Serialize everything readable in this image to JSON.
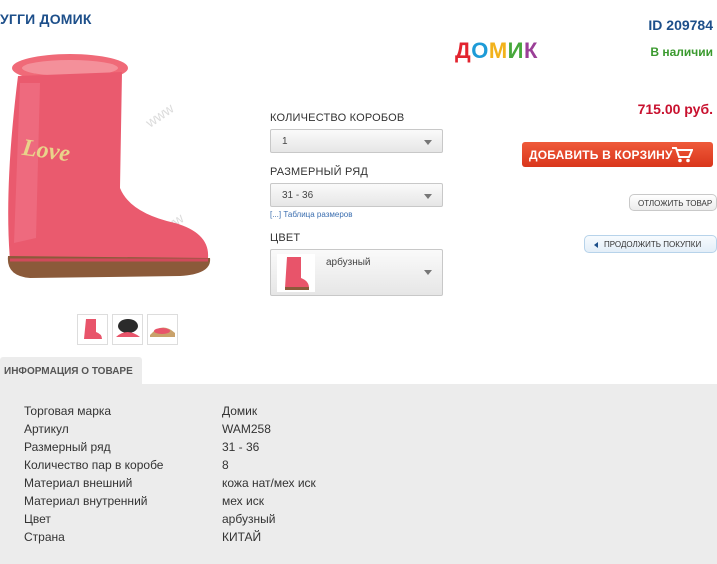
{
  "product": {
    "title": "УГГИ ДОМИК",
    "id_label": "ID 209784",
    "brand_logo": "ДОМИК",
    "stock": "В наличии",
    "price": "715.00 руб.",
    "main_color": "#e8546a"
  },
  "options": {
    "boxes_label": "КОЛИЧЕСТВО КОРОБОВ",
    "boxes_value": "1",
    "size_label": "РАЗМЕРНЫЙ РЯД",
    "size_value": "31 - 36",
    "size_table_link": "[...] Таблица размеров",
    "color_label": "ЦВЕТ",
    "color_value": "арбузный"
  },
  "actions": {
    "add_to_cart": "ДОБАВИТЬ В КОРЗИНУ",
    "postpone": "ОТЛОЖИТЬ ТОВАР",
    "continue": "ПРОДОЛЖИТЬ ПОКУПКИ"
  },
  "info_tab": "ИНФОРМАЦИЯ О ТОВАРЕ",
  "specs": [
    {
      "k": "Торговая марка",
      "v": "Домик"
    },
    {
      "k": "Артикул",
      "v": "WAM258"
    },
    {
      "k": "Размерный ряд",
      "v": "31 - 36"
    },
    {
      "k": "Количество пар в коробе",
      "v": "8"
    },
    {
      "k": "Материал внешний",
      "v": "кожа нат/мех иск"
    },
    {
      "k": "Материал внутренний",
      "v": "мех иск"
    },
    {
      "k": "Цвет",
      "v": "арбузный"
    },
    {
      "k": "Страна",
      "v": "КИТАЙ"
    }
  ],
  "watermark": "www.vzxx.ru"
}
